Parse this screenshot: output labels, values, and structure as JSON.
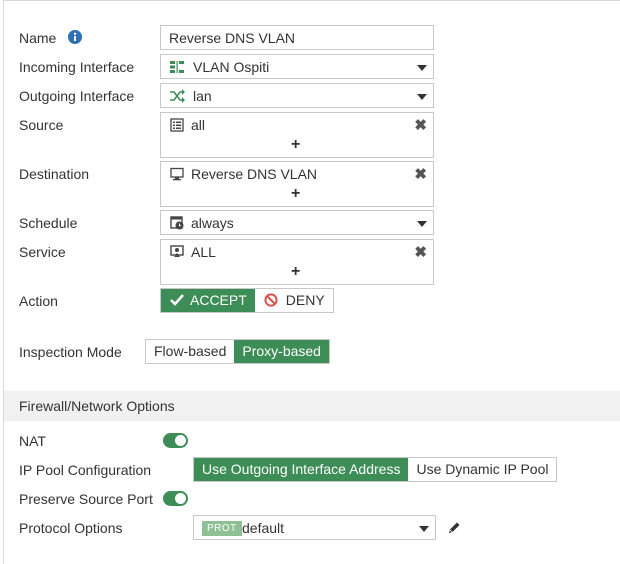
{
  "form": {
    "name": {
      "label": "Name",
      "value": "Reverse DNS VLAN",
      "info_icon": "info-icon"
    },
    "incoming_interface": {
      "label": "Incoming Interface",
      "value": "VLAN Ospiti",
      "icon": "vlan-interface-icon"
    },
    "outgoing_interface": {
      "label": "Outgoing Interface",
      "value": "lan",
      "icon": "shuffle-interface-icon"
    },
    "source": {
      "label": "Source",
      "value": "all",
      "icon": "address-list-icon",
      "add": "+"
    },
    "destination": {
      "label": "Destination",
      "value": "Reverse DNS VLAN",
      "icon": "monitor-address-icon",
      "add": "+"
    },
    "schedule": {
      "label": "Schedule",
      "value": "always",
      "icon": "calendar-clock-icon"
    },
    "service": {
      "label": "Service",
      "value": "ALL",
      "icon": "service-icon",
      "add": "+"
    },
    "action": {
      "label": "Action",
      "accept": "ACCEPT",
      "deny": "DENY",
      "selected": "accept"
    },
    "inspection_mode": {
      "label": "Inspection Mode",
      "options": [
        "Flow-based",
        "Proxy-based"
      ],
      "selected": "Proxy-based"
    }
  },
  "firewall_options": {
    "title": "Firewall/Network Options",
    "nat": {
      "label": "NAT",
      "enabled": true
    },
    "ip_pool": {
      "label": "IP Pool Configuration",
      "options": [
        "Use Outgoing Interface Address",
        "Use Dynamic IP Pool"
      ],
      "selected": "Use Outgoing Interface Address"
    },
    "preserve_source_port": {
      "label": "Preserve Source Port",
      "enabled": true
    },
    "protocol_options": {
      "label": "Protocol Options",
      "badge": "PROT",
      "value": "default",
      "edit_icon": "pencil-icon"
    }
  },
  "colors": {
    "accent_green": "#3d8d56",
    "info_blue": "#2f6fb3",
    "deny_red": "#d9534f",
    "prot_badge": "#8fbf95"
  }
}
